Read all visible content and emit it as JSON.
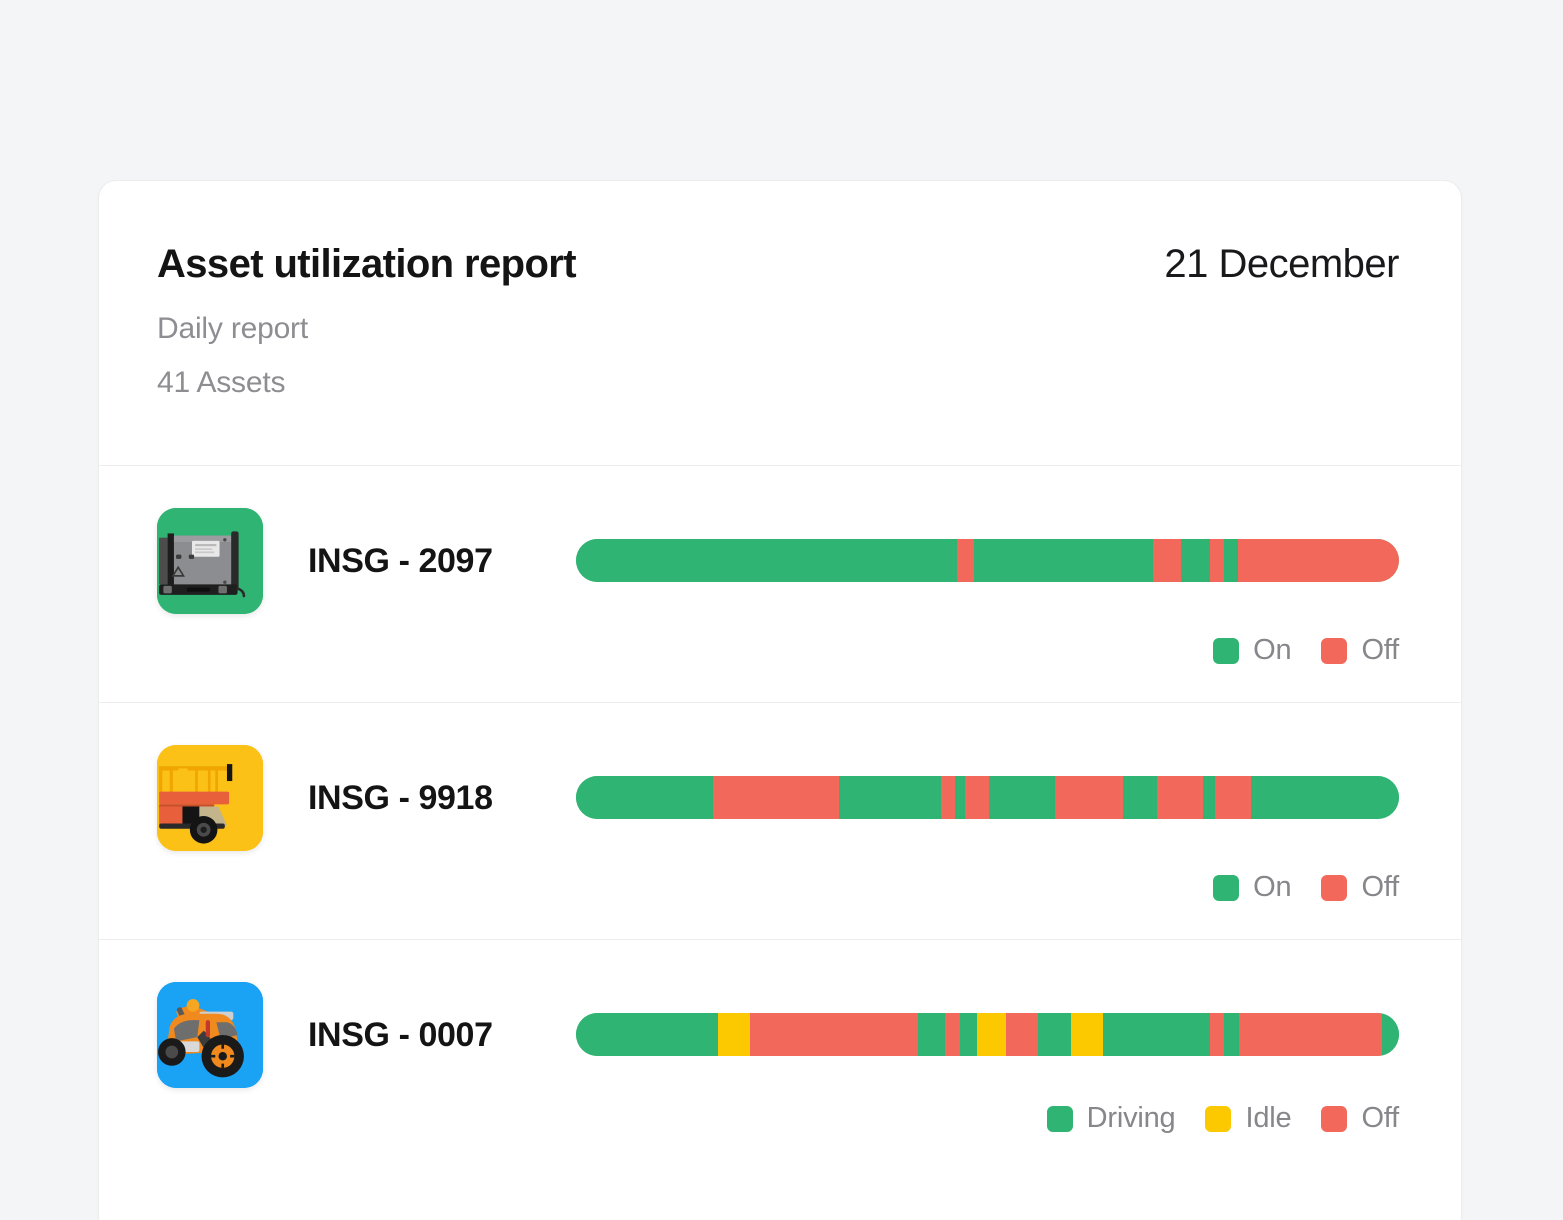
{
  "header": {
    "title": "Asset utilization report",
    "date": "21 December",
    "subtitle": "Daily report",
    "asset_count": "41 Assets"
  },
  "colors": {
    "on": "#2FB473",
    "driving": "#2FB473",
    "idle": "#FCC900",
    "off": "#F2695C",
    "page_background": "#F4F5F6",
    "card_background": "#FFFFFF",
    "divider": "#EDEDEE",
    "title_text": "#141414",
    "muted_text": "#8D8D92",
    "legend_text": "#86868B"
  },
  "rows": [
    {
      "name": "INSG - 2097",
      "icon": "generator-icon",
      "thumb_color": "#2FB473",
      "legend": [
        {
          "label": "On",
          "color": "#2FB473"
        },
        {
          "label": "Off",
          "color": "#F2695C"
        }
      ],
      "segments": [
        {
          "state": "On",
          "color": "#2FB473",
          "percent": 46.3
        },
        {
          "state": "Off",
          "color": "#F2695C",
          "percent": 2.0
        },
        {
          "state": "On",
          "color": "#2FB473",
          "percent": 21.8
        },
        {
          "state": "Off",
          "color": "#F2695C",
          "percent": 3.4
        },
        {
          "state": "On",
          "color": "#2FB473",
          "percent": 3.5
        },
        {
          "state": "Off",
          "color": "#F2695C",
          "percent": 1.8
        },
        {
          "state": "On",
          "color": "#2FB473",
          "percent": 1.6
        },
        {
          "state": "Off",
          "color": "#F2695C",
          "percent": 19.6
        }
      ]
    },
    {
      "name": "INSG - 9918",
      "icon": "scissor-lift-icon",
      "thumb_color": "#FBC117",
      "legend": [
        {
          "label": "On",
          "color": "#2FB473"
        },
        {
          "label": "Off",
          "color": "#F2695C"
        }
      ],
      "segments": [
        {
          "state": "On",
          "color": "#2FB473",
          "percent": 16.7
        },
        {
          "state": "Off",
          "color": "#F2695C",
          "percent": 15.2
        },
        {
          "state": "On",
          "color": "#2FB473",
          "percent": 12.5
        },
        {
          "state": "Off",
          "color": "#F2695C",
          "percent": 1.6
        },
        {
          "state": "On",
          "color": "#2FB473",
          "percent": 1.3
        },
        {
          "state": "Off",
          "color": "#F2695C",
          "percent": 2.9
        },
        {
          "state": "On",
          "color": "#2FB473",
          "percent": 8.0
        },
        {
          "state": "Off",
          "color": "#F2695C",
          "percent": 8.3
        },
        {
          "state": "On",
          "color": "#2FB473",
          "percent": 4.1
        },
        {
          "state": "Off",
          "color": "#F2695C",
          "percent": 5.6
        },
        {
          "state": "On",
          "color": "#2FB473",
          "percent": 1.5
        },
        {
          "state": "Off",
          "color": "#F2695C",
          "percent": 4.3
        },
        {
          "state": "On",
          "color": "#2FB473",
          "percent": 18.0
        }
      ]
    },
    {
      "name": "INSG - 0007",
      "icon": "atv-quad-bike-icon",
      "thumb_color": "#1AA2F5",
      "legend": [
        {
          "label": "Driving",
          "color": "#2FB473"
        },
        {
          "label": "Idle",
          "color": "#FCC900"
        },
        {
          "label": "Off",
          "color": "#F2695C"
        }
      ],
      "segments": [
        {
          "state": "Driving",
          "color": "#2FB473",
          "percent": 17.2
        },
        {
          "state": "Idle",
          "color": "#FCC900",
          "percent": 4.0
        },
        {
          "state": "Off",
          "color": "#F2695C",
          "percent": 20.3
        },
        {
          "state": "Driving",
          "color": "#2FB473",
          "percent": 3.4
        },
        {
          "state": "Off",
          "color": "#F2695C",
          "percent": 1.8
        },
        {
          "state": "Driving",
          "color": "#2FB473",
          "percent": 2.0
        },
        {
          "state": "Idle",
          "color": "#FCC900",
          "percent": 3.6
        },
        {
          "state": "Off",
          "color": "#F2695C",
          "percent": 3.8
        },
        {
          "state": "Driving",
          "color": "#2FB473",
          "percent": 4.1
        },
        {
          "state": "Idle",
          "color": "#FCC900",
          "percent": 3.8
        },
        {
          "state": "Driving",
          "color": "#2FB473",
          "percent": 13.0
        },
        {
          "state": "Off",
          "color": "#F2695C",
          "percent": 1.8
        },
        {
          "state": "Driving",
          "color": "#2FB473",
          "percent": 1.8
        },
        {
          "state": "Off",
          "color": "#F2695C",
          "percent": 17.4
        },
        {
          "state": "Driving",
          "color": "#2FB473",
          "percent": 2.0
        }
      ]
    }
  ]
}
